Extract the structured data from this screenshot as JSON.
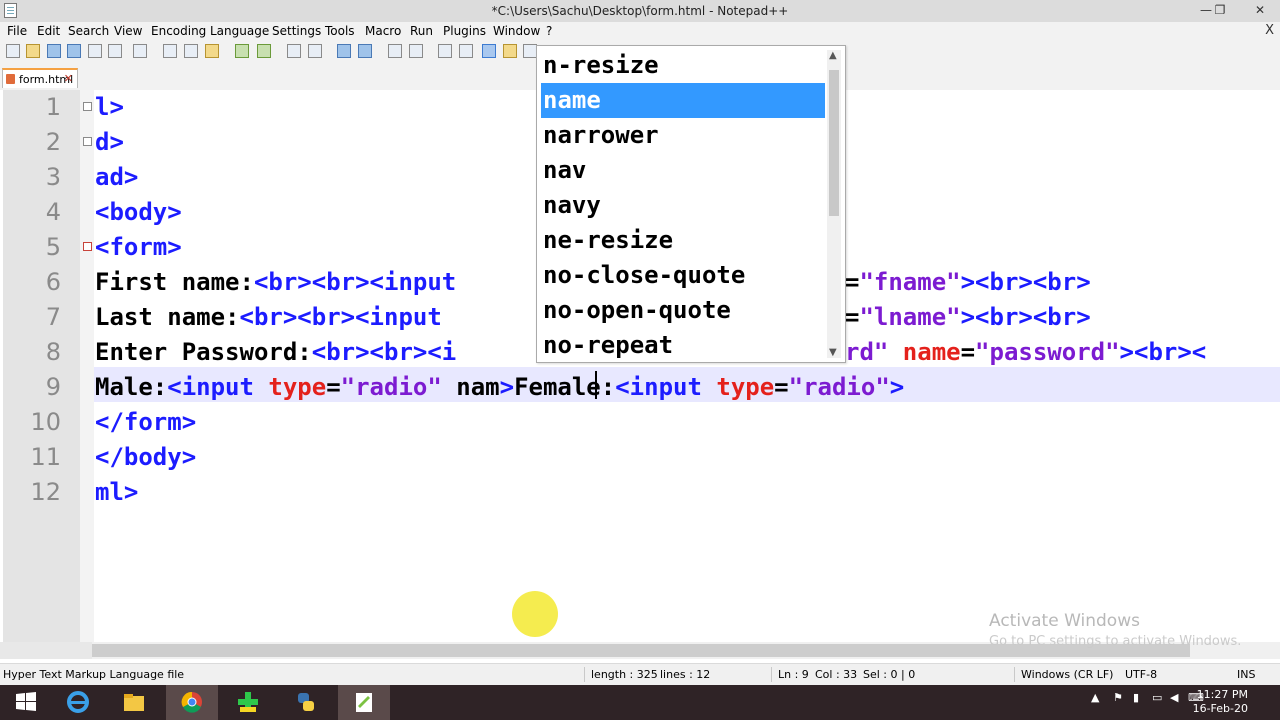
{
  "window": {
    "title": "*C:\\Users\\Sachu\\Desktop\\form.html - Notepad++",
    "controls": {
      "minimize": "—",
      "restore": "❐",
      "close": "✕"
    }
  },
  "menu": {
    "items": [
      "File",
      "Edit",
      "Search",
      "View",
      "Encoding",
      "Language",
      "Settings",
      "Tools",
      "Macro",
      "Run",
      "Plugins",
      "Window",
      "?"
    ],
    "close": "X"
  },
  "tab": {
    "label": "form.html",
    "close": "✕"
  },
  "editor": {
    "line_numbers": [
      "1",
      "2",
      "3",
      "4",
      "5",
      "6",
      "7",
      "8",
      "9",
      "10",
      "11",
      "12"
    ],
    "lines": [
      [
        [
          "tag",
          "l>"
        ]
      ],
      [
        [
          "tag",
          "d>"
        ]
      ],
      [
        [
          "tag",
          "ad>"
        ]
      ],
      [
        [
          "tag",
          "<body>"
        ]
      ],
      [
        [
          "tag",
          "<form>"
        ]
      ],
      [
        [
          "txt",
          "First name:"
        ],
        [
          "tag",
          "<br><br><input"
        ]
      ],
      [
        [
          "txt",
          "Last name:"
        ],
        [
          "tag",
          "<br><br><input"
        ]
      ],
      [
        [
          "txt",
          "Enter Password:"
        ],
        [
          "tag",
          "<br><br><i"
        ]
      ],
      [
        [
          "txt",
          "Male:"
        ],
        [
          "tag",
          "<input "
        ],
        [
          "attr",
          "type"
        ],
        [
          "op",
          "="
        ],
        [
          "val",
          "\"radio\""
        ],
        [
          "txt",
          " nam"
        ],
        [
          "tag",
          ">"
        ],
        [
          "txt",
          "Female:"
        ],
        [
          "tag",
          "<input "
        ],
        [
          "attr",
          "type"
        ],
        [
          "op",
          "="
        ],
        [
          "val",
          "\"radio\""
        ],
        [
          "tag",
          ">"
        ]
      ],
      [
        [
          "tag",
          "</form>"
        ]
      ],
      [
        [
          "tag",
          "</body>"
        ]
      ],
      [
        [
          "tag",
          "ml>"
        ]
      ]
    ],
    "line_tails": [
      [],
      [],
      [],
      [],
      [],
      [
        [
          "op",
          "="
        ],
        [
          "val",
          "\"fname\""
        ],
        [
          "tag",
          "><br><br>"
        ]
      ],
      [
        [
          "op",
          "="
        ],
        [
          "val",
          "\"lname\""
        ],
        [
          "tag",
          "><br><br>"
        ]
      ],
      [
        [
          "val",
          "rd\" "
        ],
        [
          "attr",
          "name"
        ],
        [
          "op",
          "="
        ],
        [
          "val",
          "\"password\""
        ],
        [
          "tag",
          "><br><"
        ]
      ],
      [],
      [],
      [],
      []
    ]
  },
  "autocomplete": {
    "items": [
      "n-resize",
      "name",
      "narrower",
      "nav",
      "navy",
      "ne-resize",
      "no-close-quote",
      "no-open-quote",
      "no-repeat"
    ],
    "selected": "name",
    "scroll_up": "▲",
    "scroll_down": "▼"
  },
  "status": {
    "file_type": "Hyper Text Markup Language file",
    "length": "length : 325",
    "lines": "lines : 12",
    "ln": "Ln : 9",
    "col": "Col : 33",
    "sel": "Sel : 0 | 0",
    "eol": "Windows (CR LF)",
    "encoding": "UTF-8",
    "mode": "INS"
  },
  "watermark": {
    "title": "Activate Windows",
    "subtitle": "Go to PC settings to activate Windows."
  },
  "taskbar": {
    "apps": [
      "windows-start",
      "internet-explorer",
      "file-explorer",
      "chrome",
      "app-green",
      "python",
      "notepad-plus-plus"
    ],
    "clock_time": "11:27 PM",
    "clock_date": "16-Feb-20"
  },
  "colors": {
    "tag": "#1c1cff",
    "attribute": "#e4211c",
    "value": "#7c1bd1",
    "selection": "#3399ff",
    "tab_accent": "#f5a142"
  }
}
